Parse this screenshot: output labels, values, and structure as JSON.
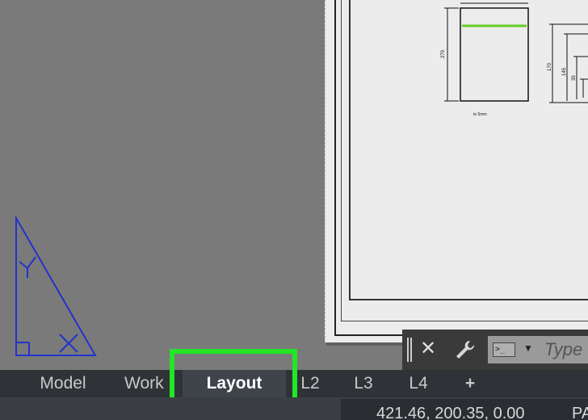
{
  "layout_tabs": [
    {
      "label": "Model",
      "active": false
    },
    {
      "label": "Work",
      "active": false
    },
    {
      "label": "Layout",
      "active": true
    },
    {
      "label": "L2",
      "active": false
    },
    {
      "label": "L3",
      "active": false
    },
    {
      "label": "L4",
      "active": false
    },
    {
      "label": "+",
      "active": false
    }
  ],
  "command_line": {
    "placeholder": "Type",
    "prompt_icon": ">_",
    "close_icon": "close-icon",
    "customize_icon": "wrench-icon"
  },
  "status_bar": {
    "coordinates": "421.46, 200.35, 0.00",
    "space_label": "PA"
  },
  "drawing": {
    "dim_left": "270",
    "dim_bottom": "to 5mm",
    "dim_right_1": "170",
    "dim_right_2": "145",
    "dim_right_3": "35"
  },
  "colors": {
    "highlight": "#22e627",
    "ucs_icon": "#2233cc",
    "green_line": "#66cc22"
  }
}
